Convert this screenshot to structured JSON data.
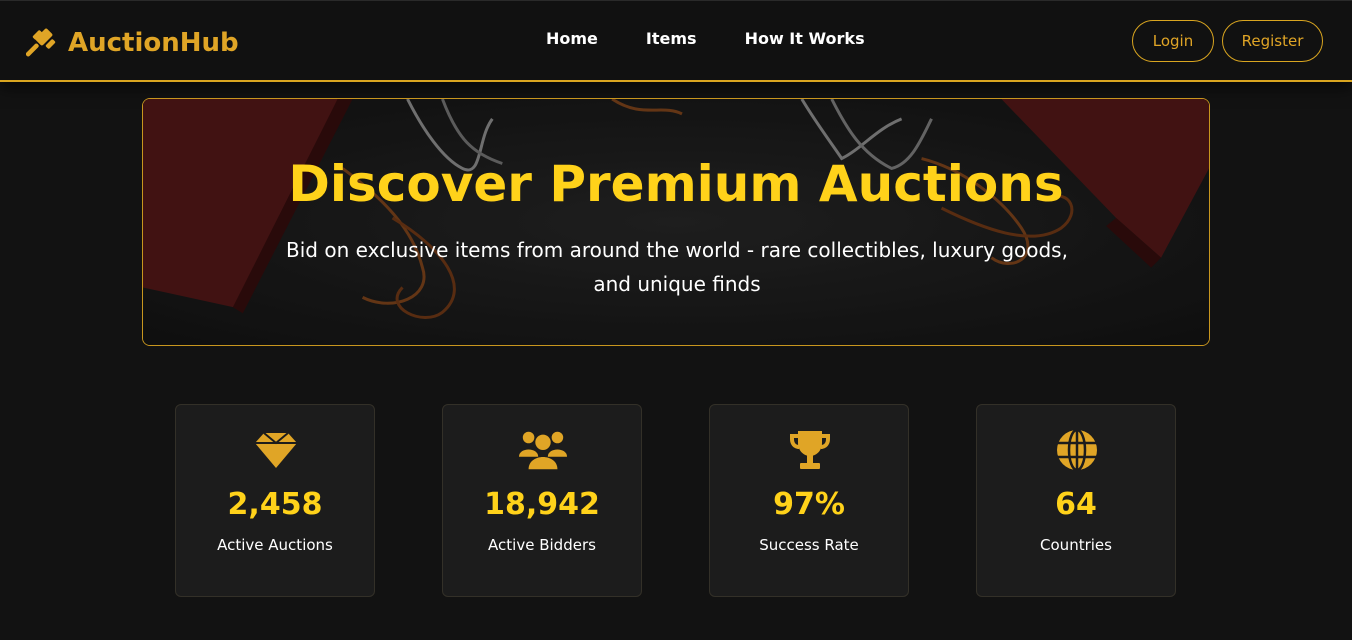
{
  "header": {
    "brand": "AuctionHub",
    "brand_icon": "gavel-icon",
    "nav": [
      {
        "label": "Home"
      },
      {
        "label": "Items"
      },
      {
        "label": "How It Works"
      }
    ],
    "login_label": "Login",
    "register_label": "Register"
  },
  "hero": {
    "title": "Discover Premium Auctions",
    "subtitle": "Bid on exclusive items from around the world - rare collectibles, luxury goods, and unique finds"
  },
  "stats": [
    {
      "icon": "diamond-icon",
      "value": "2,458",
      "label": "Active Auctions"
    },
    {
      "icon": "users-icon",
      "value": "18,942",
      "label": "Active Bidders"
    },
    {
      "icon": "trophy-icon",
      "value": "97%",
      "label": "Success Rate"
    },
    {
      "icon": "globe-icon",
      "value": "64",
      "label": "Countries"
    }
  ],
  "colors": {
    "accent": "#e0a526",
    "highlight": "#ffd21a",
    "background": "#121212",
    "card": "#1c1c1c"
  }
}
